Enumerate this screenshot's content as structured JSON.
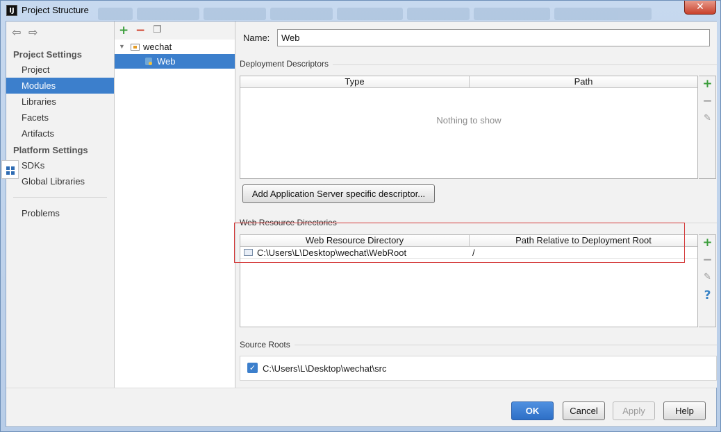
{
  "window": {
    "title": "Project Structure",
    "app_icon": "intellij-icon",
    "close_label": "✕"
  },
  "sidebar": {
    "project_settings_label": "Project Settings",
    "platform_settings_label": "Platform Settings",
    "items": [
      {
        "label": "Project",
        "selected": false
      },
      {
        "label": "Modules",
        "selected": true
      },
      {
        "label": "Libraries",
        "selected": false
      },
      {
        "label": "Facets",
        "selected": false
      },
      {
        "label": "Artifacts",
        "selected": false
      },
      {
        "label": "SDKs",
        "selected": false
      },
      {
        "label": "Global Libraries",
        "selected": false
      },
      {
        "label": "Problems",
        "selected": false
      }
    ],
    "icons": [
      "back-arrow-icon",
      "forward-arrow-icon"
    ]
  },
  "tree": {
    "module_name": "wechat",
    "facet_name": "Web"
  },
  "main": {
    "name_label": "Name:",
    "name_value": "Web",
    "deployment_descriptors": {
      "heading": "Deployment Descriptors",
      "columns": [
        "Type",
        "Path"
      ],
      "empty_text": "Nothing to show",
      "add_button": "Add Application Server specific descriptor..."
    },
    "web_resource_directories": {
      "heading": "Web Resource Directories",
      "columns": [
        "Web Resource Directory",
        "Path Relative to Deployment Root"
      ],
      "rows": [
        {
          "directory": "C:\\Users\\L\\Desktop\\wechat\\WebRoot",
          "path": "/"
        }
      ]
    },
    "source_roots": {
      "heading": "Source Roots",
      "items": [
        {
          "path": "C:\\Users\\L\\Desktop\\wechat\\src",
          "checked": true
        }
      ]
    }
  },
  "footer": {
    "ok": "OK",
    "cancel": "Cancel",
    "apply": "Apply",
    "help": "Help"
  },
  "colors": {
    "selection": "#3c7fcc",
    "add_green": "#3a9d3a",
    "remove_red": "#d0402c",
    "help_blue": "#3a84c6",
    "annotation_red": "#d43a3a"
  }
}
